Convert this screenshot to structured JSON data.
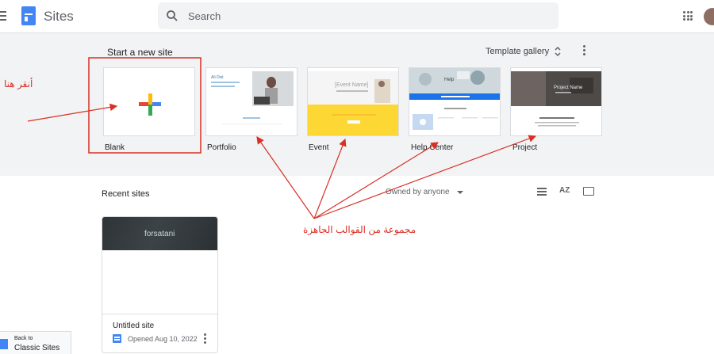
{
  "header": {
    "app_title": "Sites",
    "search_placeholder": "Search"
  },
  "templates": {
    "start_label": "Start a new site",
    "gallery_label": "Template gallery",
    "items": [
      {
        "label": "Blank"
      },
      {
        "label": "Portfolio",
        "preview_title": "Ali Dist"
      },
      {
        "label": "Event",
        "preview_title": "[Event Name]"
      },
      {
        "label": "Help Center",
        "preview_title": "Help"
      },
      {
        "label": "Project",
        "preview_title": "Project Name"
      }
    ]
  },
  "recent": {
    "title": "Recent sites",
    "owner_filter": "Owned by anyone",
    "sort_label": "AZ",
    "site": {
      "banner_text": "forsatani",
      "name": "Untitled site",
      "opened": "Opened Aug 10, 2022"
    }
  },
  "classic": {
    "line1": "Back to",
    "line2": "Classic Sites"
  },
  "annotations": {
    "click_here": "أنقر هنا",
    "templates_note": "مجموعة من القوالب الجاهزة"
  },
  "colors": {
    "accent_blue": "#4285f4",
    "annotation_red": "#d93025",
    "event_yellow": "#fdd835",
    "help_blue": "#1a73e8"
  }
}
